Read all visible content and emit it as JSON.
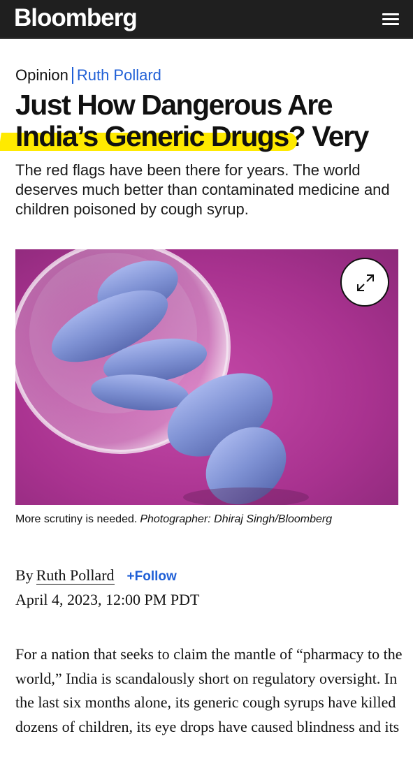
{
  "header": {
    "logo": "Bloomberg",
    "menu_icon": "hamburger-menu-icon",
    "background": "#1f1f1f"
  },
  "article": {
    "section": "Opinion",
    "author": "Ruth Pollard",
    "headline_highlighted": "India’s Generic Drugs",
    "headline_before": "Just How Dangerous Are",
    "headline_after": "? Very",
    "dek": "The red flags have been there for years. The world deserves much better than contaminated medicine and children poisoned by cough syrup.",
    "image": {
      "expand_icon": "expand-arrows-icon"
    },
    "caption": "More scrutiny is needed.",
    "photo_credit": "Photographer: Dhiraj Singh/Bloomberg",
    "byline_prefix": "By",
    "byline_name": "Ruth Pollard",
    "follow_label": "+Follow",
    "date": "April 4, 2023, 12:00 PM PDT",
    "body": "For a nation that seeks to claim the mantle of “pharmacy to the world,” India is scandalously short on regulatory oversight. In the last six months alone, its generic cough syrups have killed dozens of children, its eye drops have caused blindness and its"
  },
  "colors": {
    "accent_link": "#1f5fd6",
    "highlight": "#ffea00",
    "photo_background": "#b03aa0",
    "pill": "#7d8fd0"
  }
}
